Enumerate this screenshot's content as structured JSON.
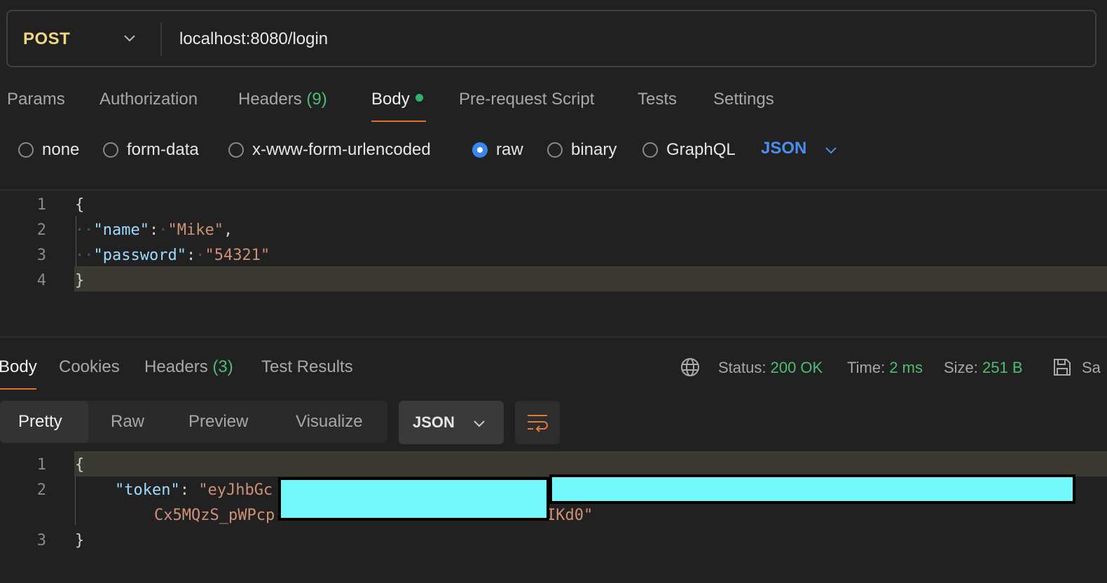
{
  "request": {
    "method": "POST",
    "url": "localhost:8080/login",
    "tabs": [
      {
        "label": "Params"
      },
      {
        "label": "Authorization"
      },
      {
        "label": "Headers",
        "count": "(9)"
      },
      {
        "label": "Body"
      },
      {
        "label": "Pre-request Script"
      },
      {
        "label": "Tests"
      },
      {
        "label": "Settings"
      }
    ],
    "body_types": [
      "none",
      "form-data",
      "x-www-form-urlencoded",
      "raw",
      "binary",
      "GraphQL"
    ],
    "selected_body_type": "raw",
    "format": "JSON",
    "body_lines": [
      "1",
      "2",
      "3",
      "4"
    ],
    "body": {
      "open": "{",
      "name_key": "\"name\"",
      "name_value": "\"Mike\"",
      "password_key": "\"password\"",
      "password_value": "\"54321\"",
      "close": "}"
    }
  },
  "response": {
    "tabs": [
      {
        "label": "Body"
      },
      {
        "label": "Cookies"
      },
      {
        "label": "Headers",
        "count": "(3)"
      },
      {
        "label": "Test Results"
      }
    ],
    "status_label": "Status:",
    "status_value": "200 OK",
    "time_label": "Time:",
    "time_value": "2 ms",
    "size_label": "Size:",
    "size_value": "251 B",
    "save_label": "Sa",
    "views": [
      "Pretty",
      "Raw",
      "Preview",
      "Visualize"
    ],
    "format": "JSON",
    "body_lines": [
      "1",
      "2",
      "3"
    ],
    "body": {
      "open": "{",
      "token_key": "\"token\"",
      "token_value_start": "\"eyJhbGc",
      "token_line2_start": "Cx5MQzS_pWPcp",
      "token_line2_end": "IKd0\"",
      "close": "}"
    }
  },
  "colors": {
    "method": "#f0d882",
    "accent_tab": "#e0703a",
    "status_green": "#4dbd74",
    "json_blue": "#4a8ff0",
    "redaction": "#73f9fc"
  }
}
